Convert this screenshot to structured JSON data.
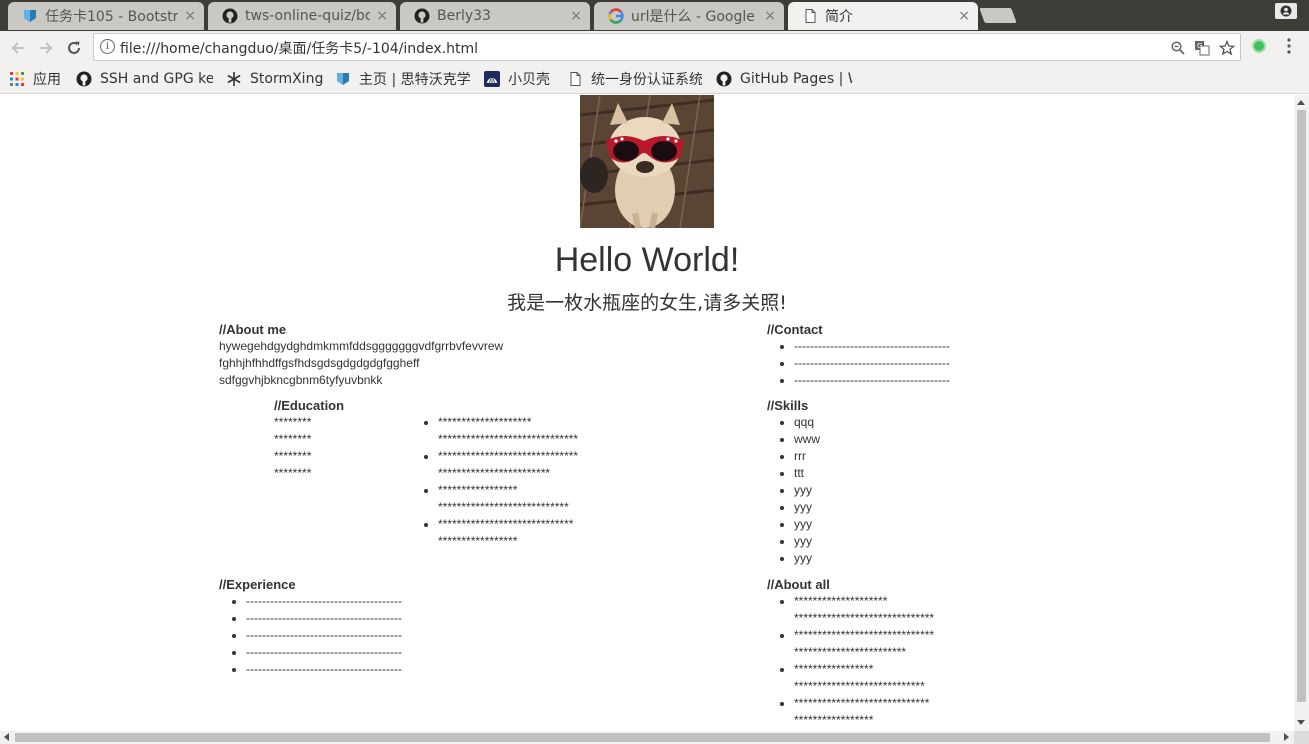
{
  "browser": {
    "tabs": [
      {
        "title": "任务卡105 - Bootstr",
        "icon": "bootstrap-icon",
        "active": false
      },
      {
        "title": "tws-online-quiz/bo",
        "icon": "github-icon",
        "active": false
      },
      {
        "title": "Berly33",
        "icon": "github-icon",
        "active": false
      },
      {
        "title": "url是什么 - Google",
        "icon": "google-icon",
        "active": false
      },
      {
        "title": "简介",
        "icon": "page-icon",
        "active": true
      }
    ],
    "close_glyph": "×",
    "url": "file:///home/changduo/桌面/任务卡5/-104/index.html",
    "bookmarks": [
      {
        "label": "应用",
        "icon": "apps-grid-icon"
      },
      {
        "label": "SSH and GPG key",
        "icon": "github-icon"
      },
      {
        "label": "StormXing",
        "icon": "snowflake-icon"
      },
      {
        "label": "主页 | 思特沃克学",
        "icon": "bootstrap-icon"
      },
      {
        "label": "小贝壳",
        "icon": "shell-icon"
      },
      {
        "label": "统一身份认证系统",
        "icon": "page-icon"
      },
      {
        "label": "GitHub Pages | W",
        "icon": "github-icon"
      }
    ]
  },
  "page": {
    "title": "Hello World!",
    "subtitle": "我是一枚水瓶座的女生,请多关照!",
    "about_me": {
      "heading": "//About me",
      "lines": [
        "hywegehdgydghdmkmmfddsgggggggvdfgrrbvfevvrew",
        "fghhjhfhhdffgsfhdsgdsgdgdgdgfggheff",
        "sdfggvhjbkncgbnm6tyfyuvbnkk"
      ]
    },
    "contact": {
      "heading": "//Contact",
      "items": [
        "---------------------------------------",
        "---------------------------------------",
        "---------------------------------------"
      ]
    },
    "education": {
      "heading": "//Education",
      "years": [
        "********",
        "********",
        "********",
        "********"
      ],
      "items": [
        [
          "********************",
          "******************************"
        ],
        [
          "******************************",
          "************************"
        ],
        [
          "*****************",
          "****************************"
        ],
        [
          "*****************************",
          "*****************"
        ]
      ]
    },
    "skills": {
      "heading": "//Skills",
      "items": [
        "qqq",
        "www",
        "rrr",
        "ttt",
        "yyy",
        "yyy",
        "yyy",
        "yyy",
        "yyy"
      ]
    },
    "experience": {
      "heading": "//Experience",
      "items": [
        "---------------------------------------",
        "---------------------------------------",
        "---------------------------------------",
        "---------------------------------------",
        "---------------------------------------"
      ]
    },
    "about_all": {
      "heading": "//About all",
      "items": [
        [
          "********************",
          "******************************"
        ],
        [
          "******************************",
          "************************"
        ],
        [
          "*****************",
          "****************************"
        ],
        [
          "*****************************",
          "*****************"
        ]
      ]
    }
  }
}
